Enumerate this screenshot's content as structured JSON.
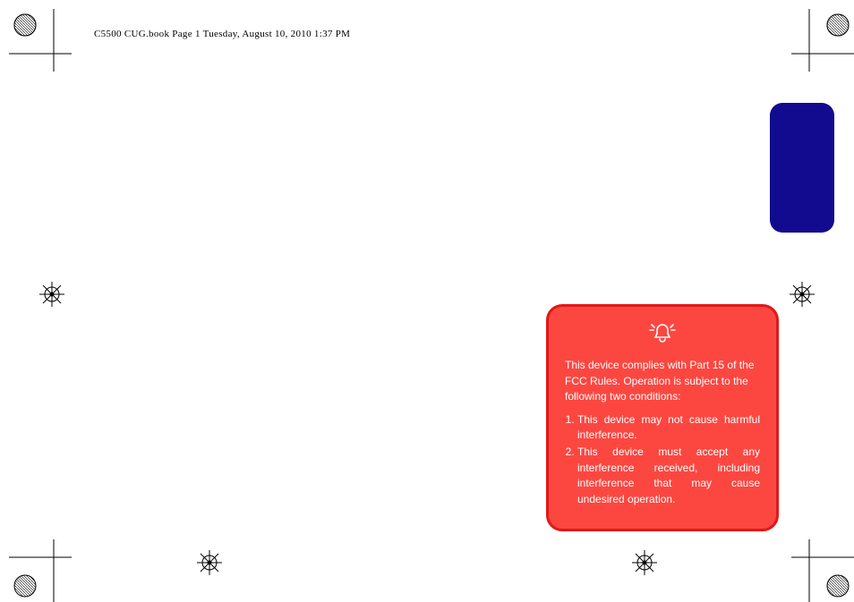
{
  "header": "C5500 CUG.book  Page 1  Tuesday, August 10, 2010  1:37 PM",
  "warning": {
    "intro": "This device complies with Part 15 of the FCC Rules. Operation is subject to the following two conditions:",
    "item1": "This device may not cause harmful interference.",
    "item2": "This device must accept any interference received, including interference that may cause undesired operation."
  }
}
